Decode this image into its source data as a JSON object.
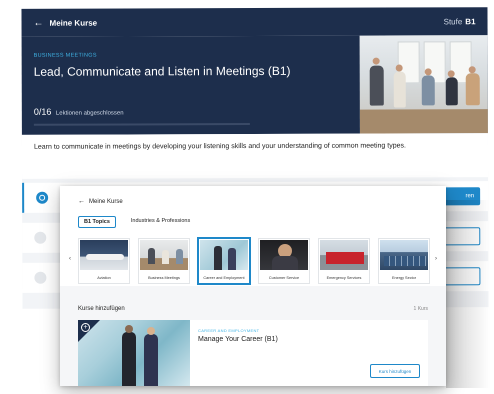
{
  "background": {
    "topbar": {
      "back_label": "Meine Kurse",
      "level_label": "Stufe",
      "level_value": "B1"
    },
    "hero": {
      "category": "BUSINESS MEETINGS",
      "title": "Lead, Communicate and Listen in Meetings (B1)",
      "progress_count": "0/16",
      "progress_label": "Lektionen abgeschlossen",
      "progress_fraction": 0
    },
    "description": "Learn to communicate in meetings by developing your listening skills and your understanding of common meeting types.",
    "row_button_label": "ren"
  },
  "overlay": {
    "back_label": "Meine Kurse",
    "tabs": [
      {
        "label": "B1 Topics",
        "active": true
      },
      {
        "label": "Industries & Professions",
        "active": false
      }
    ],
    "topics": [
      {
        "label": "Aviation"
      },
      {
        "label": "Business Meetings"
      },
      {
        "label": "Career and Employment",
        "selected": true
      },
      {
        "label": "Customer Service"
      },
      {
        "label": "Emergency Services"
      },
      {
        "label": "Energy Sector"
      }
    ],
    "add_section": {
      "title": "Kurse hinzufügen",
      "count": "1 Kurs"
    },
    "card": {
      "category": "CAREER AND EMPLOYMENT",
      "title": "Manage Your Career (B1)",
      "button_label": "Kurs hinzufügen"
    }
  },
  "colors": {
    "navy": "#1d2e4c",
    "accent": "#1e88c9",
    "cyan": "#3fb4e6"
  },
  "icons": [
    "back-arrow-icon",
    "chevron-left-icon",
    "chevron-right-icon",
    "plus-circle-icon",
    "lesson-status-icon"
  ]
}
